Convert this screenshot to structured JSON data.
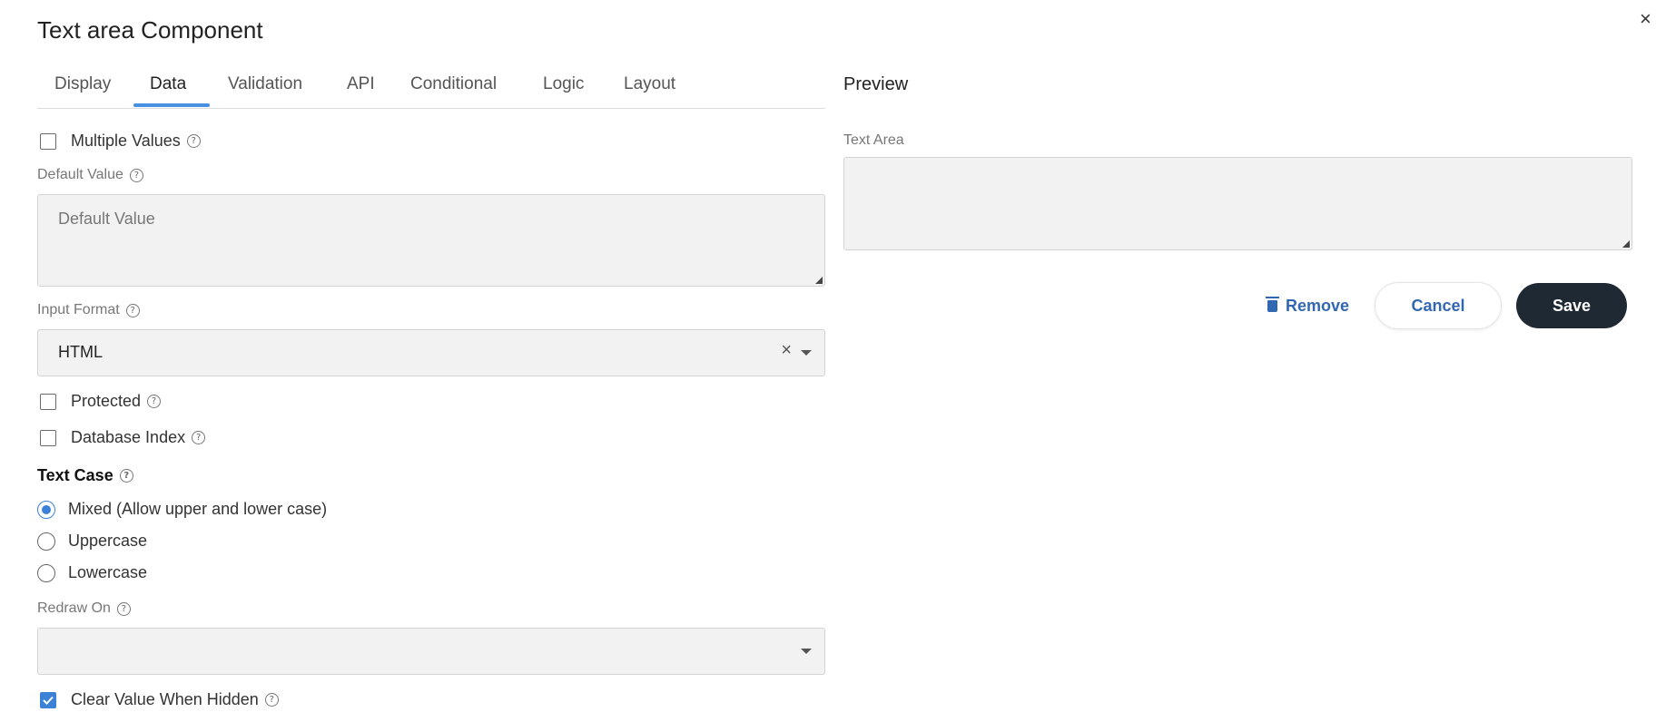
{
  "dialog": {
    "title": "Text area Component",
    "close_icon": "×"
  },
  "tabs": [
    {
      "label": "Display",
      "active": false
    },
    {
      "label": "Data",
      "active": true
    },
    {
      "label": "Validation",
      "active": false
    },
    {
      "label": "API",
      "active": false
    },
    {
      "label": "Conditional",
      "active": false
    },
    {
      "label": "Logic",
      "active": false
    },
    {
      "label": "Layout",
      "active": false
    }
  ],
  "form": {
    "multiple_values": {
      "label": "Multiple Values",
      "checked": false
    },
    "default_value": {
      "label": "Default Value",
      "placeholder": "Default Value"
    },
    "input_format": {
      "label": "Input Format",
      "value": "HTML",
      "clear_glyph": "×"
    },
    "protected": {
      "label": "Protected",
      "checked": false
    },
    "database_index": {
      "label": "Database Index",
      "checked": false
    },
    "text_case": {
      "label": "Text Case",
      "options": [
        {
          "label": "Mixed (Allow upper and lower case)",
          "checked": true
        },
        {
          "label": "Uppercase",
          "checked": false
        },
        {
          "label": "Lowercase",
          "checked": false
        }
      ]
    },
    "redraw_on": {
      "label": "Redraw On",
      "value": ""
    },
    "clear_value_when_hidden": {
      "label": "Clear Value When Hidden",
      "checked": true
    }
  },
  "preview": {
    "title": "Preview",
    "field_label": "Text Area"
  },
  "actions": {
    "remove_label": "Remove",
    "cancel_label": "Cancel",
    "save_label": "Save"
  },
  "help_glyph": "?",
  "colors": {
    "accent": "#3b82d6",
    "primary_button": "#1f2933",
    "link": "#3267b2"
  }
}
